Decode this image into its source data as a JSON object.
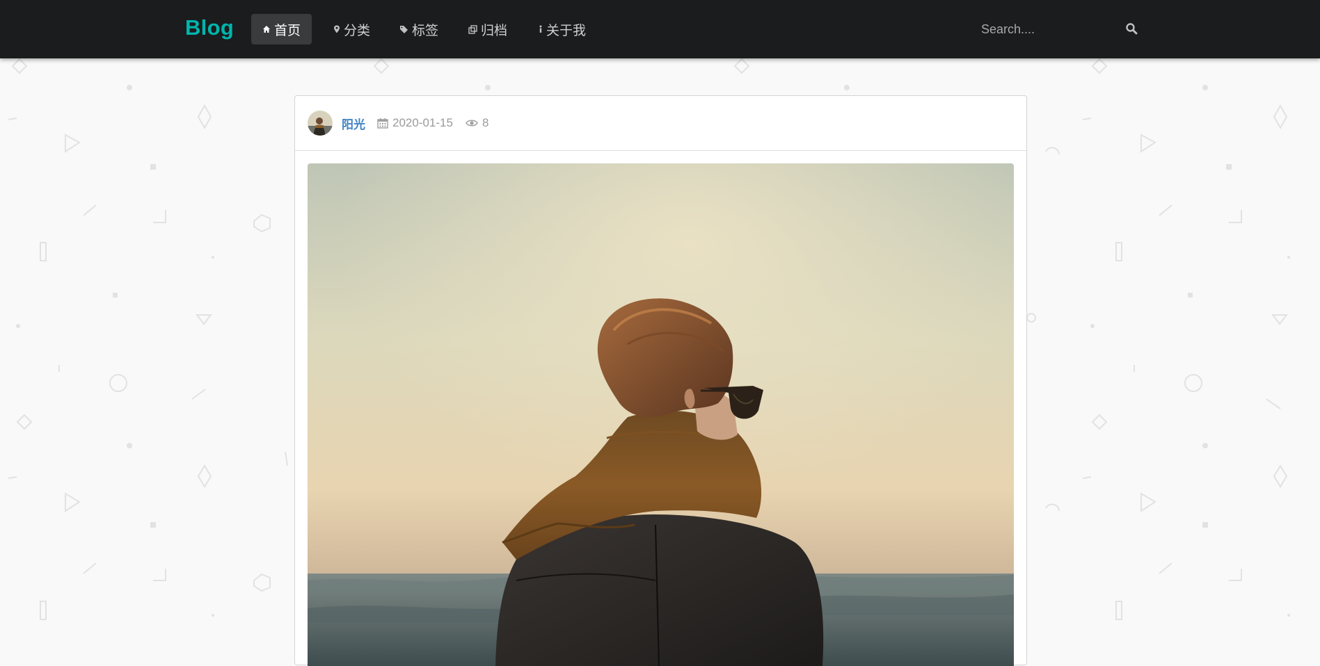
{
  "nav": {
    "brand": "Blog",
    "items": [
      {
        "label": "首页",
        "icon": "home-icon",
        "active": true
      },
      {
        "label": "分类",
        "icon": "map-marker-icon",
        "active": false
      },
      {
        "label": "标签",
        "icon": "tag-icon",
        "active": false
      },
      {
        "label": "归档",
        "icon": "clone-icon",
        "active": false
      },
      {
        "label": "关于我",
        "icon": "info-icon",
        "active": false
      }
    ],
    "search_placeholder": "Search...."
  },
  "post": {
    "author": "阳光",
    "date": "2020-01-15",
    "views": "8",
    "image_subject": "person-with-scarf-facing-sea"
  },
  "colors": {
    "navbar": "#1b1c1d",
    "brand": "#00b5ad",
    "author_link": "#4183c4",
    "page_bg": "#f9f9f9"
  }
}
